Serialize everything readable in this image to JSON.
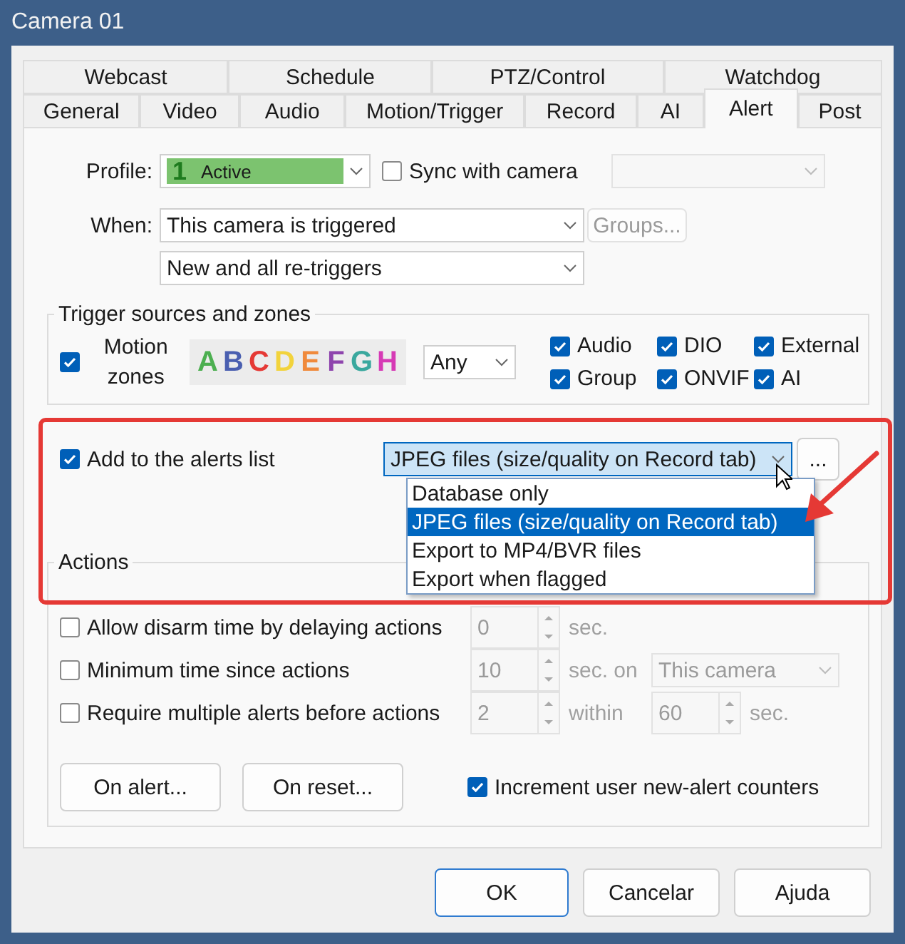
{
  "window": {
    "title": "Camera 01"
  },
  "tab_rows": [
    [
      {
        "label": "Webcast",
        "selected": false
      },
      {
        "label": "Schedule",
        "selected": false
      },
      {
        "label": "PTZ/Control",
        "selected": false
      },
      {
        "label": "Watchdog",
        "selected": false
      }
    ],
    [
      {
        "label": "General",
        "selected": false
      },
      {
        "label": "Video",
        "selected": false
      },
      {
        "label": "Audio",
        "selected": false
      },
      {
        "label": "Motion/Trigger",
        "selected": false
      },
      {
        "label": "Record",
        "selected": false
      },
      {
        "label": "AI",
        "selected": false
      },
      {
        "label": "Alert",
        "selected": true
      },
      {
        "label": "Post",
        "selected": false
      }
    ]
  ],
  "profile": {
    "label": "Profile:",
    "number": "1",
    "value": "Active",
    "color": "#7cc36f"
  },
  "sync": {
    "label": "Sync with camera",
    "checked": false
  },
  "when": {
    "label": "When:",
    "value": "This camera is triggered",
    "retrigger": "New and all re-triggers"
  },
  "groups_button": {
    "label": "Groups...",
    "disabled": true
  },
  "trigger_sources": {
    "title": "Trigger sources and zones",
    "motion": {
      "label": "Motion zones",
      "checked": true
    },
    "zones": [
      {
        "letter": "A",
        "color": "#4caf50"
      },
      {
        "letter": "B",
        "color": "#4a5fb0"
      },
      {
        "letter": "C",
        "color": "#e53935"
      },
      {
        "letter": "D",
        "color": "#f2d33c"
      },
      {
        "letter": "E",
        "color": "#f08a3c"
      },
      {
        "letter": "F",
        "color": "#8e44ad"
      },
      {
        "letter": "G",
        "color": "#3aa89e"
      },
      {
        "letter": "H",
        "color": "#d63ab5"
      }
    ],
    "zone_mode": "Any",
    "sources": [
      {
        "label": "Audio",
        "checked": true
      },
      {
        "label": "DIO",
        "checked": true
      },
      {
        "label": "External",
        "checked": true
      },
      {
        "label": "Group",
        "checked": true
      },
      {
        "label": "ONVIF",
        "checked": true
      },
      {
        "label": "AI",
        "checked": true
      }
    ]
  },
  "alerts_list": {
    "label": "Add to the alerts list",
    "checked": true,
    "value": "JPEG files (size/quality on Record tab)",
    "more_button": "...",
    "options": [
      {
        "label": "Database only",
        "selected": false
      },
      {
        "label": "JPEG files (size/quality on Record tab)",
        "selected": true
      },
      {
        "label": "Export to MP4/BVR files",
        "selected": false
      },
      {
        "label": "Export when flagged",
        "selected": false
      }
    ]
  },
  "actions": {
    "title": "Actions",
    "rows": [
      {
        "label": "Allow disarm time by delaying actions",
        "checked": false,
        "controls": [
          {
            "kind": "spin",
            "value": "0"
          },
          {
            "kind": "unit",
            "text": "sec."
          }
        ]
      },
      {
        "label": "Minimum time since actions",
        "checked": false,
        "controls": [
          {
            "kind": "spin",
            "value": "10"
          },
          {
            "kind": "unit",
            "text": "sec. on"
          },
          {
            "kind": "select",
            "value": "This camera"
          }
        ]
      },
      {
        "label": "Require multiple alerts before actions",
        "checked": false,
        "controls": [
          {
            "kind": "spin",
            "value": "2"
          },
          {
            "kind": "unit",
            "text": "within"
          },
          {
            "kind": "spin",
            "value": "60"
          },
          {
            "kind": "unit",
            "text": "sec."
          }
        ]
      }
    ],
    "buttons": [
      {
        "label": "On alert..."
      },
      {
        "label": "On reset..."
      }
    ],
    "increment": {
      "label": "Increment user new-alert counters",
      "checked": true
    }
  },
  "footer_buttons": [
    {
      "label": "OK",
      "default": true
    },
    {
      "label": "Cancelar",
      "default": false
    },
    {
      "label": "Ajuda",
      "default": false
    }
  ]
}
